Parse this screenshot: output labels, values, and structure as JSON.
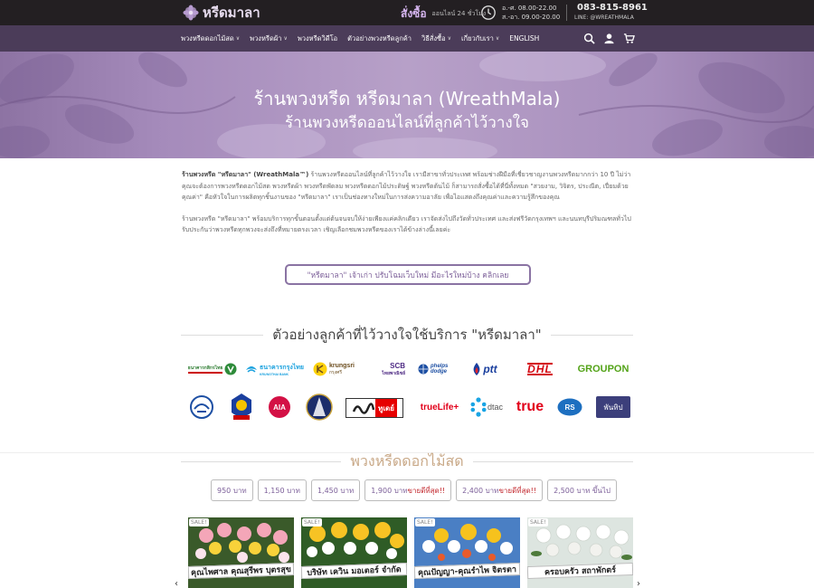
{
  "header": {
    "logo_text": "หรีดมาลา",
    "order_big": "สั่งซื้อ",
    "order_small": "ออนไลน์ 24 ชั่วโมง",
    "hours_line1": "อ.-ศ. 08.00-22.00",
    "hours_line2": "ส.-อา. 09.00-20.00",
    "phone": "083-815-8961",
    "line_id": "LINE: @WREATHMALA"
  },
  "nav": {
    "items": [
      {
        "label": "พวงหรีดดอกไม้สด",
        "dropdown": true
      },
      {
        "label": "พวงหรีดผ้า",
        "dropdown": true
      },
      {
        "label": "พวงหรีดวิดีโอ",
        "dropdown": false
      },
      {
        "label": "ตัวอย่างพวงหรีดลูกค้า",
        "dropdown": false
      },
      {
        "label": "วิธีสั่งซื้อ",
        "dropdown": true
      },
      {
        "label": "เกี่ยวกับเรา",
        "dropdown": true
      },
      {
        "label": "ENGLISH",
        "dropdown": false
      }
    ],
    "icons": [
      "search-icon",
      "user-icon",
      "cart-icon"
    ]
  },
  "hero": {
    "line1": "ร้านพวงหรีด หรีดมาลา (WreathMala)",
    "line2": "ร้านพวงหรีดออนไลน์ที่ลูกค้าไว้วางใจ"
  },
  "intro": {
    "p1_bold": "ร้านพวงหรีด \"หรีดมาลา\" (WreathMala™)",
    "p1_rest": " ร้านพวงหรีดออนไลน์ที่ลูกค้าไว้วางใจ เรามีสาขาทั่วประเทศ พร้อมช่างฝีมือที่เชี่ยวชาญงานพวงหรีดมากกว่า 10 ปี ไม่ว่าคุณจะต้องการพวงหรีดดอกไม้สด พวงหรีดผ้า พวงหรีดพัดลม พวงหรีดดอกไม้ประดิษฐ์ พวงหรีดต้นไม้ ก็สามารถสั่งซื้อได้ที่นี่ทั้งหมด \"สวยงาม, วิจิตร, ประณีต, เปี่ยมด้วยคุณค่า\" คือหัวใจในการผลิตทุกชิ้นงานของ \"หรีดมาลา\" เราเป็นช่องทางใหม่ในการส่งความอาลัย เพื่อไอแสดงถึงคุณค่าและความรู้สึกของคุณ",
    "p2": "ร้านพวงหรีด \"หรีดมาลา\" พร้อมบริการทุกขั้นตอนตั้งแต่ต้นจนจบให้ง่ายเพียงแค่คลิกเดียว เราจัดส่งไปถึงวัดทั่วประเทศ และส่งฟรีวัดกรุงเทพฯ และนนทบุรีปริมณฑลทั่วไป รับประกันว่าพวงหรีดทุกพวงจะส่งถึงที่หมายตรงเวลา เชิญเลือกชมพวงหรีดของเราได้ข้างล่างนี้เลยค่ะ"
  },
  "cta_label": "\"หรีดมาลา\" เจ้าเก่า ปรับโฉมเว็บใหม่ มีอะไรใหม่บ้าง คลิกเลย",
  "customers": {
    "title": "ตัวอย่างลูกค้าที่ไว้วางใจใช้บริการ \"หรีดมาลา\"",
    "logos": [
      "ธนาคารกสิกรไทย",
      "ธนาคารกรุงไทย",
      "krungsri",
      "SCB",
      "phelps dodge",
      "ptt",
      "DHL",
      "GROUPON",
      "AOT",
      "Emblem",
      "AIA",
      "Government seal",
      "Pan Pacific",
      "trueLife+",
      "dtac",
      "true",
      "RS",
      "Pantip"
    ],
    "logo_texts": {
      "kbank": "ธนาคารกสิกรไทย",
      "ktb_main": "ธนาคารกรุงไทย",
      "ktb_sub": "KRUNGTHAI BANK",
      "krungsri_main": "krungsri",
      "krungsri_sub": "กรุงศรี",
      "scb_main": "SCB",
      "scb_sub": "ไทยพาณิชย์",
      "phelps": "phelps dodge",
      "ptt": "ptt",
      "dhl": "DHL",
      "groupon": "GROUPON",
      "aia": "AIA",
      "nation": "ทูเดย์",
      "truelife": "trueLife+",
      "dtac": "dtac",
      "true": "true",
      "rs": "RS",
      "pantip": "พันทิป"
    }
  },
  "flowers": {
    "title": "พวงหรีดดอกไม้สด",
    "filters": [
      {
        "label": "950 บาท",
        "hot": ""
      },
      {
        "label": "1,150 บาท",
        "hot": ""
      },
      {
        "label": "1,450 บาท",
        "hot": ""
      },
      {
        "label": "1,900 บาท ",
        "hot": "ขายดีที่สุด!!"
      },
      {
        "label": "2,400 บาท ",
        "hot": "ขายดีที่สุด!!"
      },
      {
        "label": "2,500 บาท ขึ้นไป",
        "hot": ""
      }
    ],
    "products": [
      {
        "sale": "SALE!",
        "ribbon": "คุณไพศาล คุณสุรีพร บุตรสุข"
      },
      {
        "sale": "SALE!",
        "ribbon": "บริษัท เควิน มอเตอร์ จำกัด"
      },
      {
        "sale": "SALE!",
        "ribbon": "คุณปัญญา-คุณรำไพ จิตรตา"
      },
      {
        "sale": "SALE!",
        "ribbon": "ครอบครัว สถาพักตร์"
      }
    ]
  },
  "colors": {
    "topbar": "#231f22",
    "nav": "#4b3c59",
    "accent": "#7c5f99",
    "hot": "#c2272d"
  }
}
